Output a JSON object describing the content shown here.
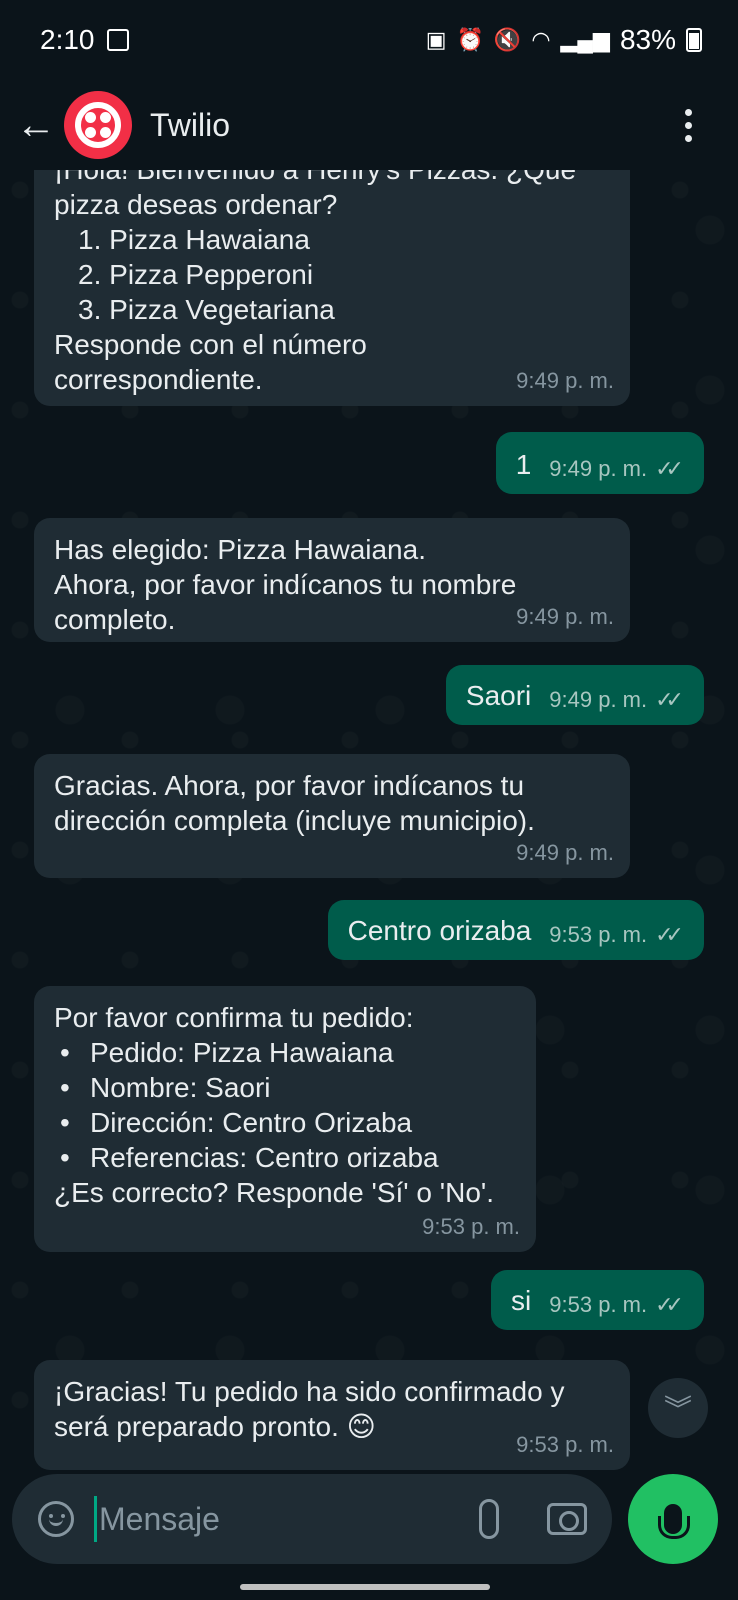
{
  "status_bar": {
    "time": "2:10",
    "battery": "83%"
  },
  "header": {
    "contact_name": "Twilio",
    "back_icon": "arrow-left-icon",
    "menu_icon": "more-vertical-icon"
  },
  "messages": [
    {
      "direction": "in",
      "lines": [
        "¡Hola! Bienvenido a Henry's Pizzas. ¿Qué",
        "pizza deseas ordenar?"
      ],
      "ordered_items": [
        "Pizza Hawaiana",
        "Pizza Pepperoni",
        "Pizza Vegetariana"
      ],
      "after_lines": [
        "Responde con el número",
        "correspondiente."
      ],
      "time": "9:49 p. m."
    },
    {
      "direction": "out",
      "text": "1",
      "time": "9:49 p. m."
    },
    {
      "direction": "in",
      "lines": [
        "Has elegido: Pizza Hawaiana.",
        "Ahora, por favor indícanos tu nombre",
        "completo."
      ],
      "time": "9:49 p. m."
    },
    {
      "direction": "out",
      "text": "Saori",
      "time": "9:49 p. m."
    },
    {
      "direction": "in",
      "lines": [
        "Gracias. Ahora, por favor indícanos tu",
        "dirección completa (incluye municipio)."
      ],
      "time": "9:49 p. m."
    },
    {
      "direction": "out",
      "text": "Centro orizaba",
      "time": "9:53 p. m."
    },
    {
      "direction": "in",
      "lines": [
        "Por favor confirma tu pedido:"
      ],
      "bullets": [
        "Pedido: Pizza Hawaiana",
        "Nombre: Saori",
        "Dirección: Centro Orizaba",
        "Referencias: Centro orizaba"
      ],
      "after_lines": [
        "¿Es correcto? Responde 'Sí' o 'No'."
      ],
      "time": "9:53 p. m."
    },
    {
      "direction": "out",
      "text": "si",
      "time": "9:53 p. m."
    },
    {
      "direction": "in",
      "lines": [
        "¡Gracias! Tu pedido ha sido confirmado y",
        "será preparado pronto. 😊"
      ],
      "time": "9:53 p. m."
    }
  ],
  "input": {
    "placeholder": "Mensaje",
    "value": ""
  },
  "colors": {
    "background": "#0b141a",
    "incoming_bubble": "#1f2c34",
    "outgoing_bubble": "#005c4b",
    "accent": "#21c063",
    "twilio_red": "#f22f46"
  }
}
